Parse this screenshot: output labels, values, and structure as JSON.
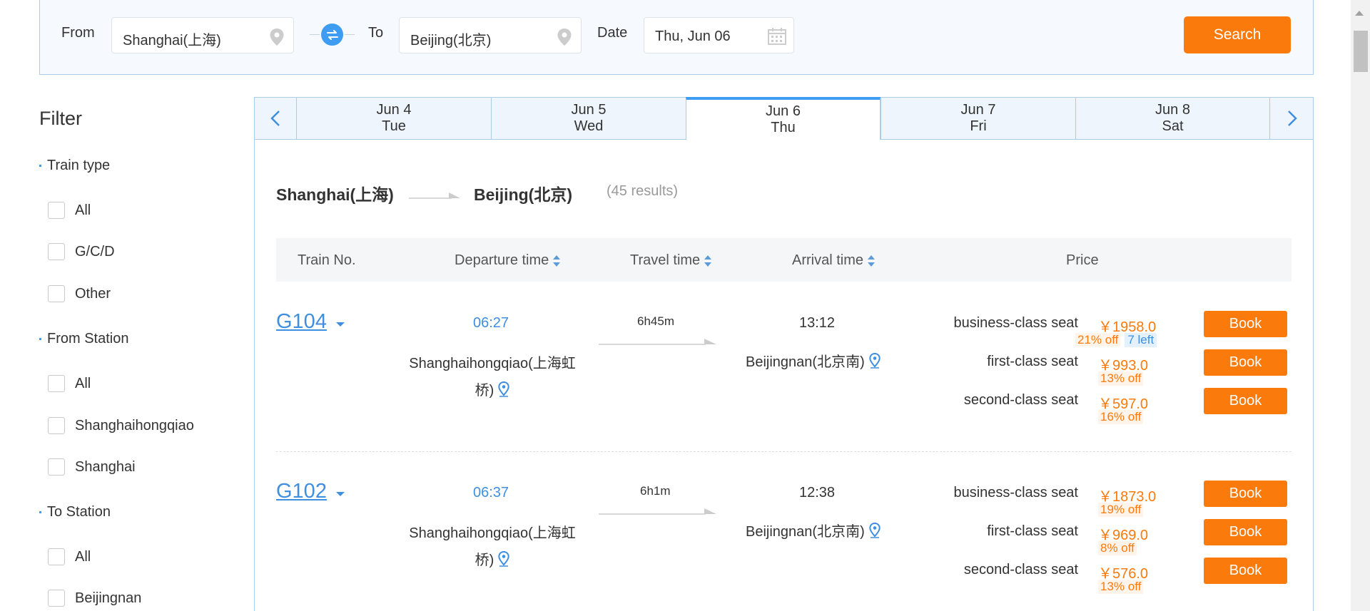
{
  "search": {
    "from_label": "From",
    "from_value": "Shanghai(上海)",
    "to_label": "To",
    "to_value": "Beijing(北京)",
    "date_label": "Date",
    "date_value": "Thu, Jun 06",
    "search_button": "Search"
  },
  "filter": {
    "title": "Filter",
    "groups": [
      {
        "title": "Train type",
        "options": [
          "All",
          "G/C/D",
          "Other"
        ]
      },
      {
        "title": "From Station",
        "options": [
          "All",
          "Shanghaihongqiao",
          "Shanghai"
        ]
      },
      {
        "title": "To Station",
        "options": [
          "All",
          "Beijingnan"
        ]
      }
    ]
  },
  "dates": [
    {
      "date": "Jun 4",
      "day": "Tue"
    },
    {
      "date": "Jun 5",
      "day": "Wed"
    },
    {
      "date": "Jun 6",
      "day": "Thu"
    },
    {
      "date": "Jun 7",
      "day": "Fri"
    },
    {
      "date": "Jun 8",
      "day": "Sat"
    }
  ],
  "route": {
    "from": "Shanghai(上海)",
    "to": "Beijing(北京)",
    "count": "(45 results)"
  },
  "table_headers": {
    "train_no": "Train No.",
    "departure": "Departure time",
    "travel": "Travel time",
    "arrival": "Arrival time",
    "price": "Price"
  },
  "trains": [
    {
      "no": "G104",
      "dep_time": "06:27",
      "dep_station_line1": "Shanghaihongqiao(上海虹",
      "dep_station_line2": "桥)",
      "travel_time": "6h45m",
      "arr_time": "13:12",
      "arr_station": "Beijingnan(北京南)",
      "seats": [
        {
          "name": "business-class seat",
          "price": "￥1958.0",
          "off": "21% off",
          "left": "7 left",
          "book": "Book"
        },
        {
          "name": "first-class seat",
          "price": "￥993.0",
          "off": "13% off",
          "left": "",
          "book": "Book"
        },
        {
          "name": "second-class seat",
          "price": "￥597.0",
          "off": "16% off",
          "left": "",
          "book": "Book"
        }
      ]
    },
    {
      "no": "G102",
      "dep_time": "06:37",
      "dep_station_line1": "Shanghaihongqiao(上海虹",
      "dep_station_line2": "桥)",
      "travel_time": "6h1m",
      "arr_time": "12:38",
      "arr_station": "Beijingnan(北京南)",
      "seats": [
        {
          "name": "business-class seat",
          "price": "￥1873.0",
          "off": "19% off",
          "left": "",
          "book": "Book"
        },
        {
          "name": "first-class seat",
          "price": "￥969.0",
          "off": "8% off",
          "left": "",
          "book": "Book"
        },
        {
          "name": "second-class seat",
          "price": "￥576.0",
          "off": "13% off",
          "left": "",
          "book": "Book"
        }
      ]
    }
  ]
}
